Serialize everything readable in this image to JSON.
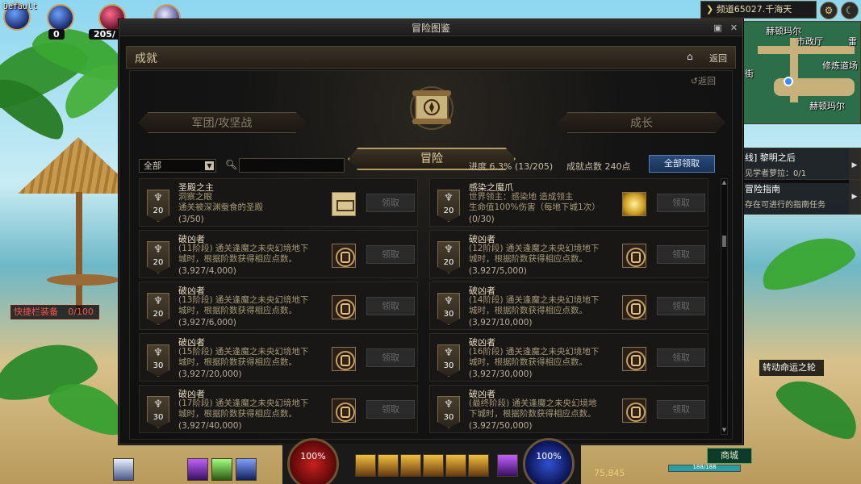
{
  "hud": {
    "profile_name": "Default",
    "count_badge": "0",
    "fatigue": "205/",
    "quickbar_label": "快捷栏装备",
    "quickbar_count": "0/100"
  },
  "topright": {
    "channel": "频道65027.千海天",
    "map_town": "赫顿玛尔",
    "map_labels": [
      "市政厅",
      "修炼道场",
      "赫顿玛尔",
      "雷",
      "街"
    ],
    "quest1_title": "线] 黎明之后",
    "quest1_sub": "见学者萝拉：0/1",
    "quest2_title": "冒险指南",
    "quest2_sub": "存在可进行的指南任务",
    "fate_label": "转动命运之轮"
  },
  "dialog": {
    "title": "冒险图鉴",
    "section_title": "成就",
    "back_label": "返回",
    "back2_label": "返回",
    "tabs": {
      "left": "军团/攻坚战",
      "center": "冒险",
      "right": "成长"
    },
    "filter": {
      "selected": "全部"
    },
    "progress": "进度  6.3% (13/205)",
    "points": "成就点数 240点",
    "claim_all": "全部领取",
    "claim_label": "领取"
  },
  "achievements": [
    {
      "name": "圣殿之主",
      "desc": "洞察之眼\n通关被深渊蚕食的圣殿",
      "progress": "(3/50)",
      "points": "20",
      "reward": "scroll"
    },
    {
      "name": "感染之魔爪",
      "desc": "世界领主：感染地      造成领主\n生命值100%伤害（每地下城1次）",
      "progress": "(0/30)",
      "points": "20",
      "reward": "gold"
    },
    {
      "name": "破凶者",
      "desc": "(11阶段) 通关逢魔之未央幻境地下\n城时，根据阶数获得相应点数。",
      "progress": "(3,927/4,000)",
      "points": "20",
      "reward": "ornament"
    },
    {
      "name": "破凶者",
      "desc": "(12阶段) 通关逢魔之未央幻境地下\n城时，根据阶数获得相应点数。",
      "progress": "(3,927/5,000)",
      "points": "20",
      "reward": "ornament"
    },
    {
      "name": "破凶者",
      "desc": "(13阶段) 通关逢魔之未央幻境地下\n城时，根据阶数获得相应点数。",
      "progress": "(3,927/6,000)",
      "points": "20",
      "reward": "ornament"
    },
    {
      "name": "破凶者",
      "desc": "(14阶段) 通关逢魔之未央幻境地下\n城时，根据阶数获得相应点数。",
      "progress": "(3,927/10,000)",
      "points": "30",
      "reward": "ornament"
    },
    {
      "name": "破凶者",
      "desc": "(15阶段) 通关逢魔之未央幻境地下\n城时，根据阶数获得相应点数。",
      "progress": "(3,927/20,000)",
      "points": "30",
      "reward": "ornament"
    },
    {
      "name": "破凶者",
      "desc": "(16阶段) 通关逢魔之未央幻境地下\n城时，根据阶数获得相应点数。",
      "progress": "(3,927/30,000)",
      "points": "30",
      "reward": "ornament"
    },
    {
      "name": "破凶者",
      "desc": "(17阶段) 通关逢魔之未央幻境地下\n城时，根据阶数获得相应点数。",
      "progress": "(3,927/40,000)",
      "points": "30",
      "reward": "ornament"
    },
    {
      "name": "破凶者",
      "desc": "(最终阶段) 通关逢魔之未央幻境地\n下城时，根据阶数获得相应点数。",
      "progress": "(3,927/50,000)",
      "points": "30",
      "reward": "ornament"
    }
  ],
  "bottom": {
    "hp_orb": "100%",
    "mp_orb": "100%",
    "gold": "75,845",
    "shop": "商城",
    "hp_text": "188/188",
    "hp_fraction": 1.0
  },
  "colors": {
    "accent_gold": "#b59a62",
    "claim_all_blue": "#2a4a7a",
    "disabled_button": "#2a2a2a"
  }
}
